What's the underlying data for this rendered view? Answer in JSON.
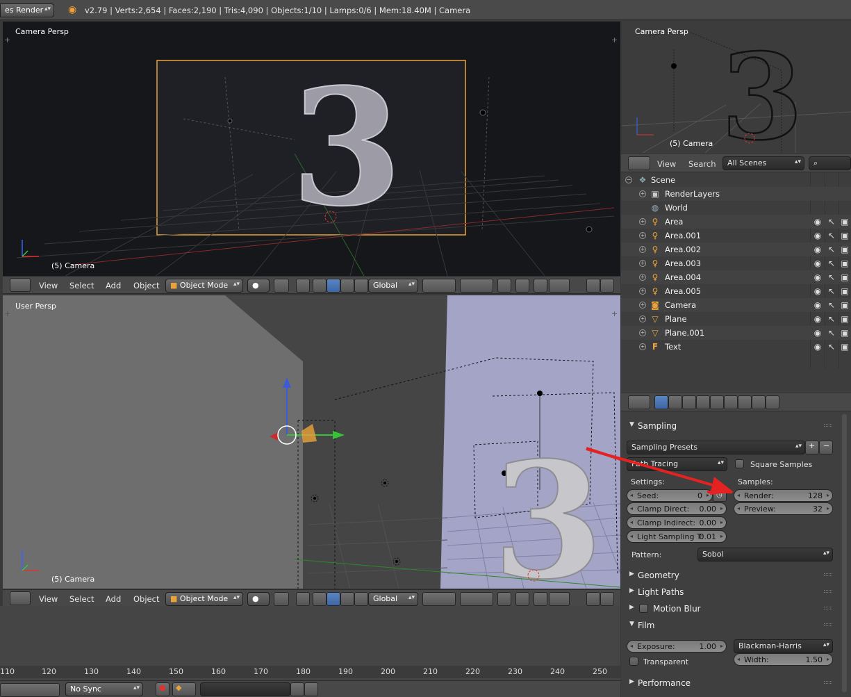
{
  "topbar": {
    "engine": "es Render",
    "stats": "v2.79 | Verts:2,654 | Faces:2,190 | Tris:4,090 | Objects:1/10 | Lamps:0/6 | Mem:18.40M | Camera"
  },
  "viewport_top": {
    "label": "Camera Persp",
    "object_label": "(5) Camera",
    "text_glyph": "3"
  },
  "viewport_bottom": {
    "label": "User Persp",
    "object_label": "(5) Camera",
    "text_glyph": "3"
  },
  "camera_preview": {
    "label": "Camera Persp",
    "object_label": "(5) Camera",
    "text_glyph": "3"
  },
  "view_header": {
    "menu_view": "View",
    "menu_select": "Select",
    "menu_add": "Add",
    "menu_object": "Object",
    "mode": "Object Mode",
    "orientation": "Global"
  },
  "outliner": {
    "menu_view": "View",
    "menu_search": "Search",
    "scenes_dropdown": "All Scenes",
    "root": "Scene",
    "items": [
      {
        "name": "RenderLayers",
        "icon": "renderlayers-icon",
        "visible_controls": false
      },
      {
        "name": "World",
        "icon": "world-icon",
        "visible_controls": false
      },
      {
        "name": "Area",
        "icon": "lamp-icon",
        "visible_controls": true
      },
      {
        "name": "Area.001",
        "icon": "lamp-icon",
        "visible_controls": true
      },
      {
        "name": "Area.002",
        "icon": "lamp-icon",
        "visible_controls": true
      },
      {
        "name": "Area.003",
        "icon": "lamp-icon",
        "visible_controls": true
      },
      {
        "name": "Area.004",
        "icon": "lamp-icon",
        "visible_controls": true
      },
      {
        "name": "Area.005",
        "icon": "lamp-icon",
        "visible_controls": true
      },
      {
        "name": "Camera",
        "icon": "camera-icon",
        "visible_controls": true
      },
      {
        "name": "Plane",
        "icon": "mesh-icon",
        "visible_controls": true
      },
      {
        "name": "Plane.001",
        "icon": "mesh-icon",
        "visible_controls": true
      },
      {
        "name": "Text",
        "icon": "font-icon",
        "visible_controls": true
      }
    ]
  },
  "properties": {
    "sampling_title": "Sampling",
    "sampling_presets": "Sampling Presets",
    "integrator": "Path Tracing",
    "square_samples": "Square Samples",
    "settings_label": "Settings:",
    "samples_label": "Samples:",
    "seed_label": "Seed:",
    "seed_value": "0",
    "clamp_direct_label": "Clamp Direct:",
    "clamp_direct_value": "0.00",
    "clamp_indirect_label": "Clamp Indirect:",
    "clamp_indirect_value": "0.00",
    "light_sampling_label": "Light Sampling T:",
    "light_sampling_value": "0.01",
    "render_label": "Render:",
    "render_value": "128",
    "preview_label": "Preview:",
    "preview_value": "32",
    "pattern_label": "Pattern:",
    "pattern_value": "Sobol",
    "geometry": "Geometry",
    "light_paths": "Light Paths",
    "motion_blur": "Motion Blur",
    "film": "Film",
    "exposure_label": "Exposure:",
    "exposure_value": "1.00",
    "filter": "Blackman-Harris",
    "transparent": "Transparent",
    "width_label": "Width:",
    "width_value": "1.50",
    "performance": "Performance"
  },
  "timeline": {
    "ticks": [
      "110",
      "120",
      "130",
      "140",
      "150",
      "160",
      "170",
      "180",
      "190",
      "200",
      "210",
      "220",
      "230",
      "240",
      "250"
    ],
    "sync": "No Sync"
  },
  "colors": {
    "annotation_arrow": "#e52222",
    "camera_frame": "#e8a33a",
    "active_blue": "#4a77b8"
  }
}
